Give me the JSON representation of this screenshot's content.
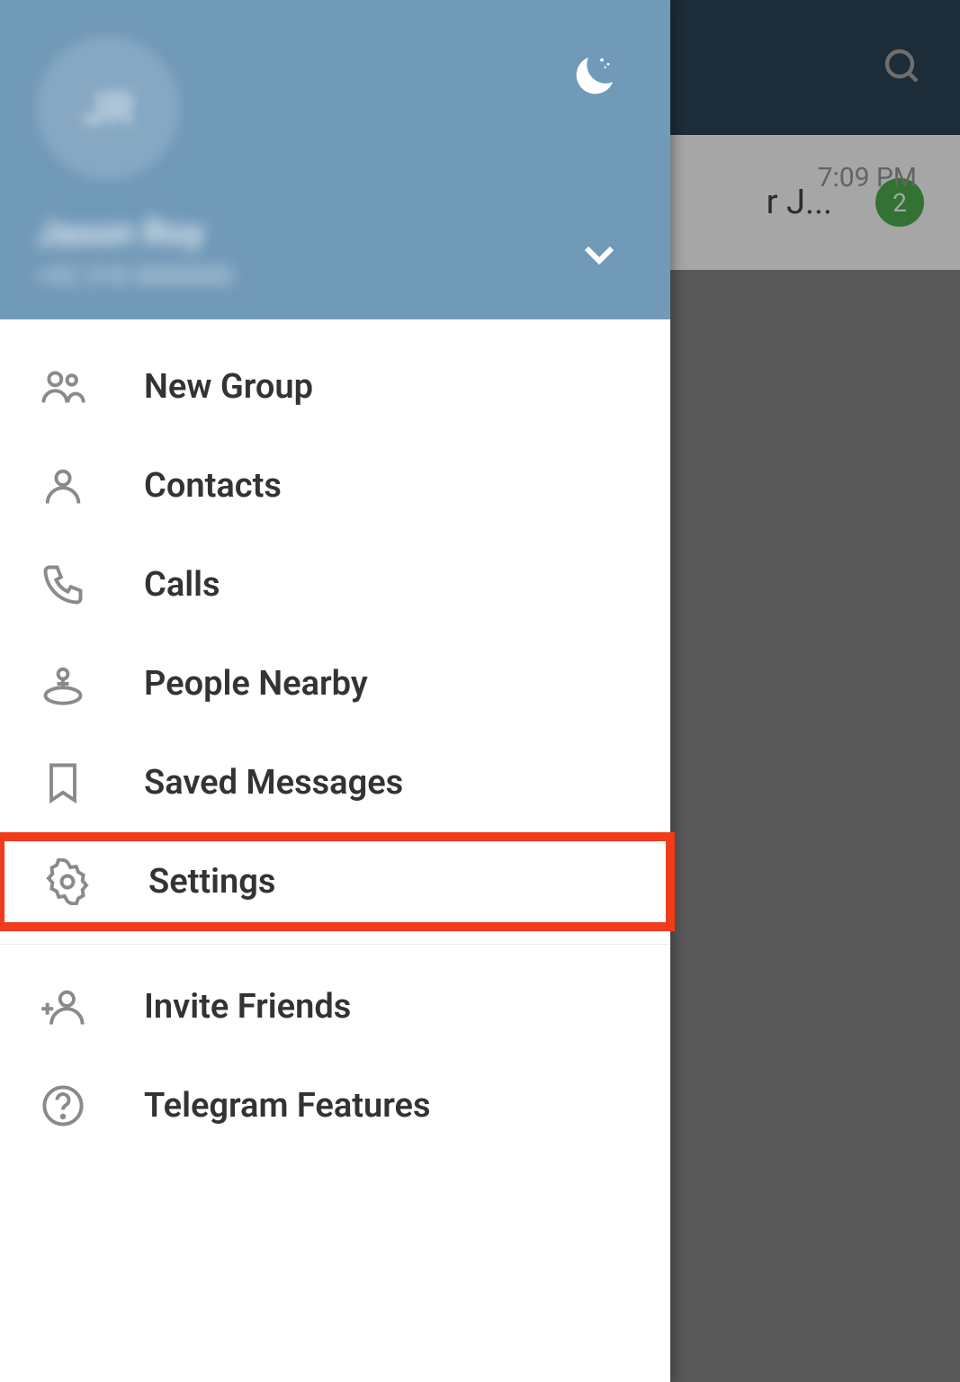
{
  "topbar": {
    "search_icon": "search"
  },
  "chat_preview": {
    "time": "7:09 PM",
    "preview_text": "r J...",
    "badge_count": "2"
  },
  "drawer": {
    "avatar_initials": "JR",
    "user_name": "Jason Roy",
    "user_phone": "+92 318 0000000",
    "menu": [
      {
        "icon": "group",
        "label": "New Group",
        "highlighted": false
      },
      {
        "icon": "person",
        "label": "Contacts",
        "highlighted": false
      },
      {
        "icon": "phone",
        "label": "Calls",
        "highlighted": false
      },
      {
        "icon": "nearby",
        "label": "People Nearby",
        "highlighted": false
      },
      {
        "icon": "bookmark",
        "label": "Saved Messages",
        "highlighted": false
      },
      {
        "icon": "gear",
        "label": "Settings",
        "highlighted": true
      }
    ],
    "menu_secondary": [
      {
        "icon": "invite",
        "label": "Invite Friends"
      },
      {
        "icon": "help",
        "label": "Telegram Features"
      }
    ]
  }
}
